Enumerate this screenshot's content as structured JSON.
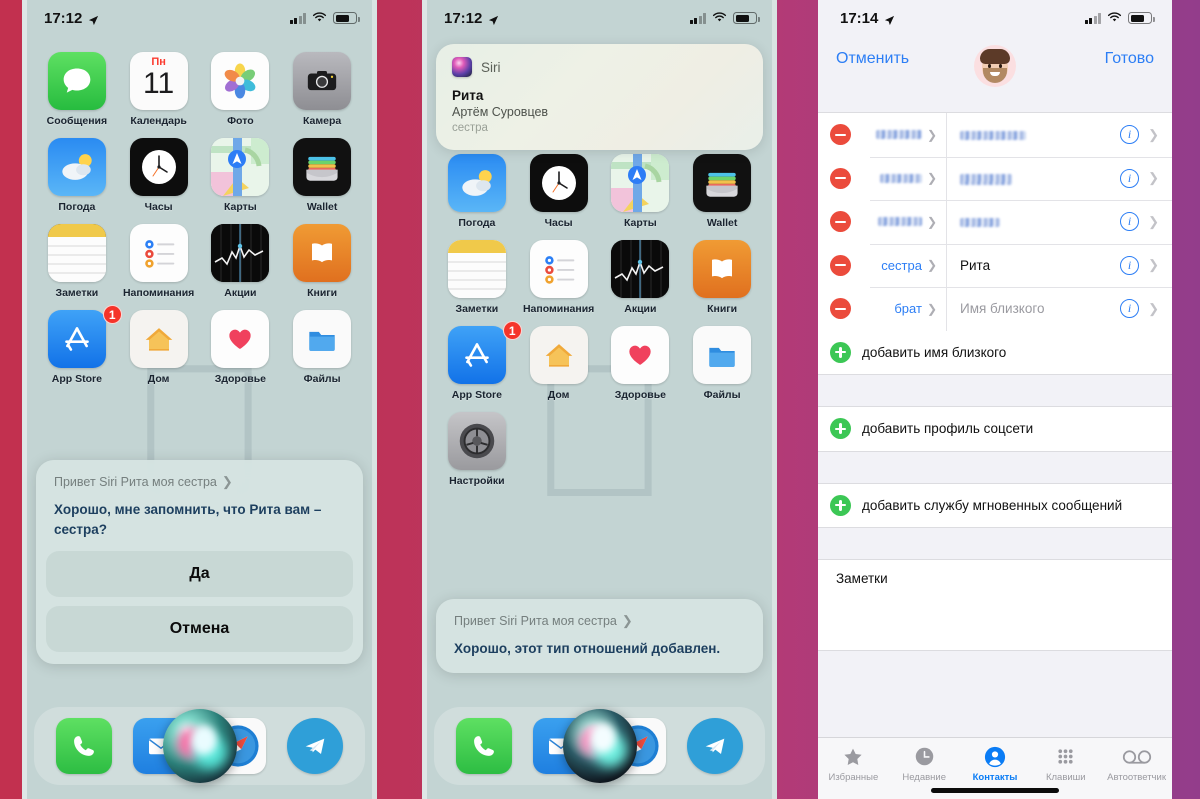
{
  "screens": [
    {
      "id": "home-siri-prompt",
      "status_bar": {
        "time": "17:12",
        "location_icon": "location-arrow-icon",
        "signal": "cellular-bars-icon",
        "wifi": "wifi-icon",
        "battery": "battery-icon"
      },
      "apps": [
        {
          "label": "Сообщения",
          "icon": "messages-icon",
          "badge": null
        },
        {
          "label": "Календарь",
          "icon": "calendar-icon",
          "badge": null,
          "day_abbr": "Пн",
          "day_number": "11"
        },
        {
          "label": "Фото",
          "icon": "photos-icon",
          "badge": null
        },
        {
          "label": "Камера",
          "icon": "camera-icon",
          "badge": null
        },
        {
          "label": "Погода",
          "icon": "weather-icon",
          "badge": null
        },
        {
          "label": "Часы",
          "icon": "clock-icon",
          "badge": null
        },
        {
          "label": "Карты",
          "icon": "maps-icon",
          "badge": null
        },
        {
          "label": "Wallet",
          "icon": "wallet-icon",
          "badge": null
        },
        {
          "label": "Заметки",
          "icon": "notes-icon",
          "badge": null
        },
        {
          "label": "Напоминания",
          "icon": "reminders-icon",
          "badge": null
        },
        {
          "label": "Акции",
          "icon": "stocks-icon",
          "badge": null
        },
        {
          "label": "Книги",
          "icon": "books-icon",
          "badge": null
        },
        {
          "label": "App Store",
          "icon": "appstore-icon",
          "badge": "1"
        },
        {
          "label": "Дом",
          "icon": "home-icon",
          "badge": null
        },
        {
          "label": "Здоровье",
          "icon": "health-icon",
          "badge": null
        },
        {
          "label": "Файлы",
          "icon": "files-icon",
          "badge": null
        }
      ],
      "siri_card": {
        "query": "Привет Siri Рита моя сестра",
        "query_chevron": "chevron-right-icon",
        "answer": "Хорошо, мне запомнить, что Рита вам – сестра?",
        "buttons": [
          "Да",
          "Отмена"
        ]
      },
      "dock": [
        {
          "label": "Телефон",
          "icon": "phone-icon"
        },
        {
          "label": "Почта",
          "icon": "mail-icon"
        },
        {
          "label": "Safari",
          "icon": "safari-icon"
        },
        {
          "label": "Telegram",
          "icon": "telegram-icon"
        }
      ],
      "siri_orb": "siri-orb-icon"
    },
    {
      "id": "home-siri-confirmed",
      "status_bar": {
        "time": "17:12",
        "location_icon": "location-arrow-icon",
        "signal": "cellular-bars-icon",
        "wifi": "wifi-icon",
        "battery": "battery-icon"
      },
      "notification": {
        "app_icon": "siri-app-icon",
        "app_name": "Siri",
        "title": "Рита",
        "subtitle": "Артём Суровцев",
        "relation": "сестра"
      },
      "apps": [
        {
          "label": "Погода",
          "icon": "weather-icon",
          "badge": null
        },
        {
          "label": "Часы",
          "icon": "clock-icon",
          "badge": null
        },
        {
          "label": "Карты",
          "icon": "maps-icon",
          "badge": null
        },
        {
          "label": "Wallet",
          "icon": "wallet-icon",
          "badge": null
        },
        {
          "label": "Заметки",
          "icon": "notes-icon",
          "badge": null
        },
        {
          "label": "Напоминания",
          "icon": "reminders-icon",
          "badge": null
        },
        {
          "label": "Акции",
          "icon": "stocks-icon",
          "badge": null
        },
        {
          "label": "Книги",
          "icon": "books-icon",
          "badge": null
        },
        {
          "label": "App Store",
          "icon": "appstore-icon",
          "badge": "1"
        },
        {
          "label": "Дом",
          "icon": "home-icon",
          "badge": null
        },
        {
          "label": "Здоровье",
          "icon": "health-icon",
          "badge": null
        },
        {
          "label": "Файлы",
          "icon": "files-icon",
          "badge": null
        },
        {
          "label": "Настройки",
          "icon": "settings-icon",
          "badge": null
        }
      ],
      "siri_card": {
        "query": "Привет Siri Рита моя сестра",
        "query_chevron": "chevron-right-icon",
        "answer": "Хорошо, этот тип отношений добавлен."
      },
      "dock": [
        {
          "label": "Телефон",
          "icon": "phone-icon"
        },
        {
          "label": "Почта",
          "icon": "mail-icon"
        },
        {
          "label": "Safari",
          "icon": "safari-icon"
        },
        {
          "label": "Telegram",
          "icon": "telegram-icon"
        }
      ],
      "siri_orb": "siri-orb-icon"
    },
    {
      "id": "contact-edit",
      "status_bar": {
        "time": "17:14",
        "location_icon": "location-arrow-icon",
        "signal": "cellular-bars-icon",
        "wifi": "wifi-icon",
        "battery": "battery-icon"
      },
      "header": {
        "cancel": "Отменить",
        "done": "Готово",
        "avatar": "memoji-avatar"
      },
      "related_rows": [
        {
          "label": "",
          "value": "",
          "redacted": true,
          "delete_icon": "minus-circle-icon",
          "info_icon": "info-circle-icon",
          "chevron": "chevron-right-icon"
        },
        {
          "label": "",
          "value": "",
          "redacted": true,
          "delete_icon": "minus-circle-icon",
          "info_icon": "info-circle-icon",
          "chevron": "chevron-right-icon"
        },
        {
          "label": "",
          "value": "",
          "redacted": true,
          "delete_icon": "minus-circle-icon",
          "info_icon": "info-circle-icon",
          "chevron": "chevron-right-icon"
        },
        {
          "label": "сестра",
          "value": "Рита",
          "redacted": false,
          "placeholder": false,
          "delete_icon": "minus-circle-icon",
          "info_icon": "info-circle-icon",
          "chevron": "chevron-right-icon"
        },
        {
          "label": "брат",
          "value": "Имя близкого",
          "redacted": false,
          "placeholder": true,
          "delete_icon": "minus-circle-icon",
          "info_icon": "info-circle-icon",
          "chevron": "chevron-right-icon"
        }
      ],
      "add_rows": [
        {
          "text": "добавить имя близкого",
          "icon": "plus-circle-icon"
        },
        {
          "text": "добавить профиль соцсети",
          "icon": "plus-circle-icon"
        },
        {
          "text": "добавить службу мгновенных сообщений",
          "icon": "plus-circle-icon"
        }
      ],
      "notes_label": "Заметки",
      "tabs": [
        {
          "label": "Избранные",
          "icon": "star-icon",
          "active": false
        },
        {
          "label": "Недавние",
          "icon": "clock-icon",
          "active": false
        },
        {
          "label": "Контакты",
          "icon": "person-circle-icon",
          "active": true
        },
        {
          "label": "Клавиши",
          "icon": "keypad-icon",
          "active": false
        },
        {
          "label": "Автоответчик",
          "icon": "voicemail-icon",
          "active": false
        }
      ]
    }
  ],
  "theme": {
    "accent_blue": "#2c7ef5",
    "delete_red": "#eb4b3c",
    "add_green": "#3cc755",
    "badge_red": "#f5342a",
    "home_bg": "#c3d4d3",
    "backdrop_left": "#c2304f",
    "backdrop_right": "#933d8b"
  }
}
